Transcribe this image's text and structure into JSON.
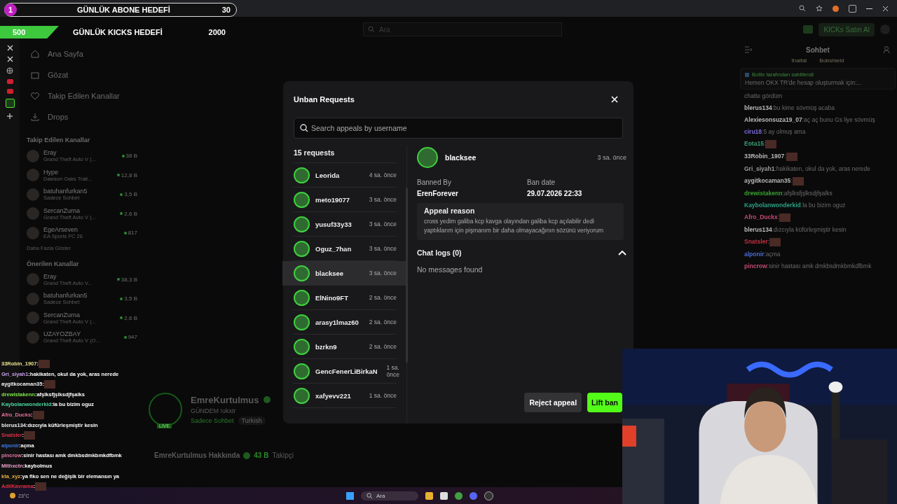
{
  "goals": [
    {
      "kind": "pink",
      "badge": "1",
      "label": "GÜNLÜK ABONE HEDEFİ",
      "value": "30"
    },
    {
      "kind": "green",
      "badge": "500",
      "label": "GÜNLÜK KICKS HEDEFİ",
      "value": "2000"
    }
  ],
  "top_bar": {
    "search": {
      "placeholder": "Ara"
    },
    "buy_button": "KICKs Satın Al"
  },
  "sidebar": {
    "nav": [
      {
        "kind": "home",
        "label": "Ana Sayfa"
      },
      {
        "kind": "browse",
        "label": "Gözat"
      },
      {
        "kind": "heart",
        "label": "Takip Edilen Kanallar"
      },
      {
        "kind": "drops",
        "label": "Drops"
      }
    ],
    "followed_title": "Takip Edilen Kanallar",
    "followed": [
      {
        "name": "Eray",
        "category": "Grand Theft Auto V (...",
        "viewers": "38 B"
      },
      {
        "name": "Hype",
        "category": "Dawson Oaks Trail...",
        "viewers": "12,8 B"
      },
      {
        "name": "batuhanfurkan5",
        "category": "Sadece Sohbet",
        "viewers": "3,5 B"
      },
      {
        "name": "SercanZurna",
        "category": "Grand Theft Auto V (...",
        "viewers": "2,6 B"
      },
      {
        "name": "EgeArseven",
        "category": "EA Sports FC 26",
        "viewers": "817"
      }
    ],
    "show_more": "Daha Fazla Göster",
    "recommended_title": "Önerilen Kanallar",
    "recommended": [
      {
        "name": "Eray",
        "category": "Grand Theft Auto V...",
        "viewers": "38,3 B"
      },
      {
        "name": "batuhanfurkan5",
        "category": "Sadece Sohbet",
        "viewers": "3,5 B"
      },
      {
        "name": "SercanZurna",
        "category": "Grand Theft Auto V (...",
        "viewers": "2,6 B"
      },
      {
        "name": "UZAYOZBAY",
        "category": "Grand Theft Auto V (O...",
        "viewers": "947"
      }
    ]
  },
  "stream_chat": [
    {
      "kind": "emote",
      "user": "33Robin_1907",
      "sep": ":",
      "color": "#e6e08a"
    },
    {
      "kind": "text",
      "user": "Gri_siyah1",
      "sep": ":",
      "color": "#c9a0e8",
      "text": "hakikaten, okul da yok, aras nerede"
    },
    {
      "kind": "emote",
      "user": "aygitkocaman35",
      "sep": ":",
      "color": "#f0f0f0"
    },
    {
      "kind": "text",
      "user": "drewistakenn",
      "sep": ":",
      "color": "#7ee84a",
      "text": "afşlksfjşlksdjfşalks"
    },
    {
      "kind": "text",
      "user": "Kaybolanwonderkid",
      "sep": ":",
      "color": "#4ad6a0",
      "text": "la bu bizim oguz"
    },
    {
      "kind": "emote",
      "user": "Afro_Ducks",
      "sep": ":",
      "color": "#e8709a"
    },
    {
      "kind": "text",
      "user": "blerus134",
      "sep": ":",
      "color": "#f0f0f0",
      "text": "dızcıyla küfürleşmiştir kesin"
    },
    {
      "kind": "emote",
      "user": "Snatsler",
      "sep": ":",
      "color": "#e0304a"
    },
    {
      "kind": "text",
      "user": "alponir",
      "sep": ":",
      "color": "#3a7ae8",
      "text": "açma"
    },
    {
      "kind": "text",
      "user": "pincrow",
      "sep": ":",
      "color": "#e878a8",
      "text": "sinir hastası amk dmkbsdmkbmkdfbmk"
    },
    {
      "kind": "text",
      "user": "Mithxctn",
      "sep": ":",
      "color": "#e8a0c8",
      "text": "kaybolmus"
    },
    {
      "kind": "text",
      "user": "kta_xyz",
      "sep": ":",
      "color": "#e8b040",
      "text": "ya fiko sen ne değişik bir elemansın ya"
    },
    {
      "kind": "emote",
      "user": "AdilKavrama",
      "sep": ":",
      "color": "#e0304a"
    }
  ],
  "modal": {
    "title": "Unban Requests",
    "search": {
      "placeholder": "Search appeals by username"
    },
    "count": "15 requests",
    "requests": [
      {
        "user": "Leorida",
        "time": "4 sa. önce",
        "selected": false
      },
      {
        "user": "meto19077",
        "time": "3 sa. önce",
        "selected": false
      },
      {
        "user": "yusuf33y33",
        "time": "3 sa. önce",
        "selected": false
      },
      {
        "user": "Oguz_7han",
        "time": "3 sa. önce",
        "selected": false
      },
      {
        "user": "blacksee",
        "time": "3 sa. önce",
        "selected": true
      },
      {
        "user": "ElNino9FT",
        "time": "2 sa. önce",
        "selected": false
      },
      {
        "user": "arasy1lmaz60",
        "time": "2 sa. önce",
        "selected": false
      },
      {
        "user": "bzrkn9",
        "time": "2 sa. önce",
        "selected": false
      },
      {
        "user": "GencFenerLiBirkaN",
        "time": "1 sa. önce",
        "selected": false
      },
      {
        "user": "xafyevv221",
        "time": "1 sa. önce",
        "selected": false
      }
    ],
    "detail": {
      "user": "blacksee",
      "time": "3 sa. önce",
      "banned_by_label": "Banned By",
      "banned_by": "ErenForever",
      "ban_date_label": "Ban date",
      "ban_date": "29.07.2026 22:33",
      "appeal_title": "Appeal reason",
      "appeal_text": "cross yedim galiba kcp kavga olayından galiba kcp açılabilir dedi yaptıklarım için pişmanım bir daha olmayacağının sözünü veriyorum",
      "chat_logs": "Chat logs (0)",
      "expanded": true,
      "empty": "No messages found"
    },
    "reject_button": "Reject appeal",
    "lift_button": "Lift ban"
  },
  "channel": {
    "badge": "LIVE",
    "name": "EmreKurtulmus",
    "title": "GÜNDEM !okxtr",
    "category": "Sadece Sohbet",
    "tag": "Turkish",
    "about": "EmreKurtulmus Hakkında",
    "followers": "43 B",
    "followers_label": "Takipçi"
  },
  "chat": {
    "title": "Sohbet",
    "top_gifters": [
      "thaifat",
      "Bobshield"
    ],
    "pinned_by": "Botlix tarafından sabitlendi",
    "pinned_text": "Hemen OKX TR'de hesap oluşturmak için:...",
    "messages": [
      {
        "kind": "text",
        "text": "chatte gördüm"
      },
      {
        "kind": "text",
        "user": "blerus134",
        "sep": ":",
        "color": "#b8b8b8",
        "text": "bu kime sövmüş acaba"
      },
      {
        "kind": "text",
        "user": "Alexiesonsuza19_07",
        "sep": ":",
        "color": "#b8b8b8",
        "text": "aç aç bunu Gs liye sövmüş"
      },
      {
        "kind": "text",
        "user": "ciru18",
        "sep": ":",
        "color": "#7a6ad8",
        "text": "5 ay olmuş ama"
      },
      {
        "kind": "emote",
        "user": "Eota15",
        "sep": ":",
        "color": "#3aa070"
      },
      {
        "kind": "emote",
        "user": "33Robin_1907",
        "sep": ":",
        "color": "#b8b8b8"
      },
      {
        "kind": "text",
        "user": "Gri_siyah1",
        "sep": ":",
        "color": "#9a9a9a",
        "text": "hakikaten, okul da yok, aras nerede"
      },
      {
        "kind": "emote",
        "user": "aygitkocaman35",
        "sep": ":",
        "color": "#b8b8b8"
      },
      {
        "kind": "text",
        "user": "drewistakenn",
        "sep": ":",
        "color": "#3aa030",
        "text": "afşlksfjşlksdjfşalks"
      },
      {
        "kind": "text",
        "user": "Kaybolanwonderkid",
        "sep": ":",
        "color": "#2aa080",
        "text": "la bu bizim oguz"
      },
      {
        "kind": "emote",
        "user": "Afro_Duckx",
        "sep": ":",
        "color": "#c04a70"
      },
      {
        "kind": "text",
        "user": "blerus134",
        "sep": ":",
        "color": "#b8b8b8",
        "text": "dızcıyla küfürleşmiştir kesin"
      },
      {
        "kind": "emote",
        "user": "Snatsler",
        "sep": ":",
        "color": "#c03040"
      },
      {
        "kind": "text",
        "user": "alponir",
        "sep": ":",
        "color": "#4a6ad0",
        "text": "açma"
      },
      {
        "kind": "text",
        "user": "pincrow",
        "sep": ":",
        "color": "#c04a70",
        "text": "sinir hastası amk dmkbsdmkbmkdfbmk"
      }
    ]
  },
  "taskbar": {
    "weather": "23°C",
    "search": {
      "placeholder": "Ara"
    }
  }
}
